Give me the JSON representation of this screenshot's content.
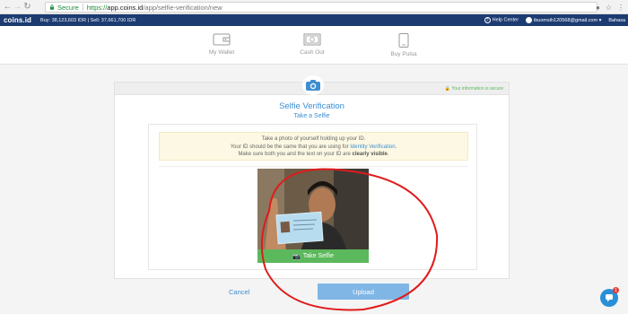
{
  "browser": {
    "secure_label": "Secure",
    "url_scheme": "https://",
    "url_host": "app.coins.id",
    "url_path": "/app/selfie-verification/new"
  },
  "topbar": {
    "logo": "coins.id",
    "prices": "Buy: 38,123,603 IDR | Sell: 37,661,700 IDR",
    "help": "Help Center",
    "user": "ibuomsih120568@gmail.com",
    "language": "Bahasa"
  },
  "wallet_nav": {
    "items": [
      {
        "label": "My Wallet",
        "icon": "wallet-icon"
      },
      {
        "label": "Cash Out",
        "icon": "cash-icon"
      },
      {
        "label": "Buy Pulsa",
        "icon": "phone-icon"
      }
    ]
  },
  "card": {
    "secure_note": "Your information is secure",
    "title": "Selfie Verification",
    "subtitle": "Take a Selfie",
    "notice_line1": "Take a photo of yourself holding up your ID.",
    "notice_line2_pre": "Your ID should be the same that you are using for ",
    "notice_line2_link": "Identity Verification",
    "notice_line2_post": ".",
    "notice_line3_pre": "Make sure both you and the text on your ID are ",
    "notice_line3_bold": "clearly visible",
    "notice_line3_post": ".",
    "take_selfie": "Take Selfie"
  },
  "actions": {
    "cancel": "Cancel",
    "upload": "Upload"
  },
  "chat": {
    "badge": "1"
  },
  "colors": {
    "brand_navy": "#1c3b71",
    "accent_blue": "#3d8ed1",
    "success_green": "#5cb85c",
    "upload_blue": "#7fb6e6",
    "annotation_red": "#e01b1b"
  }
}
